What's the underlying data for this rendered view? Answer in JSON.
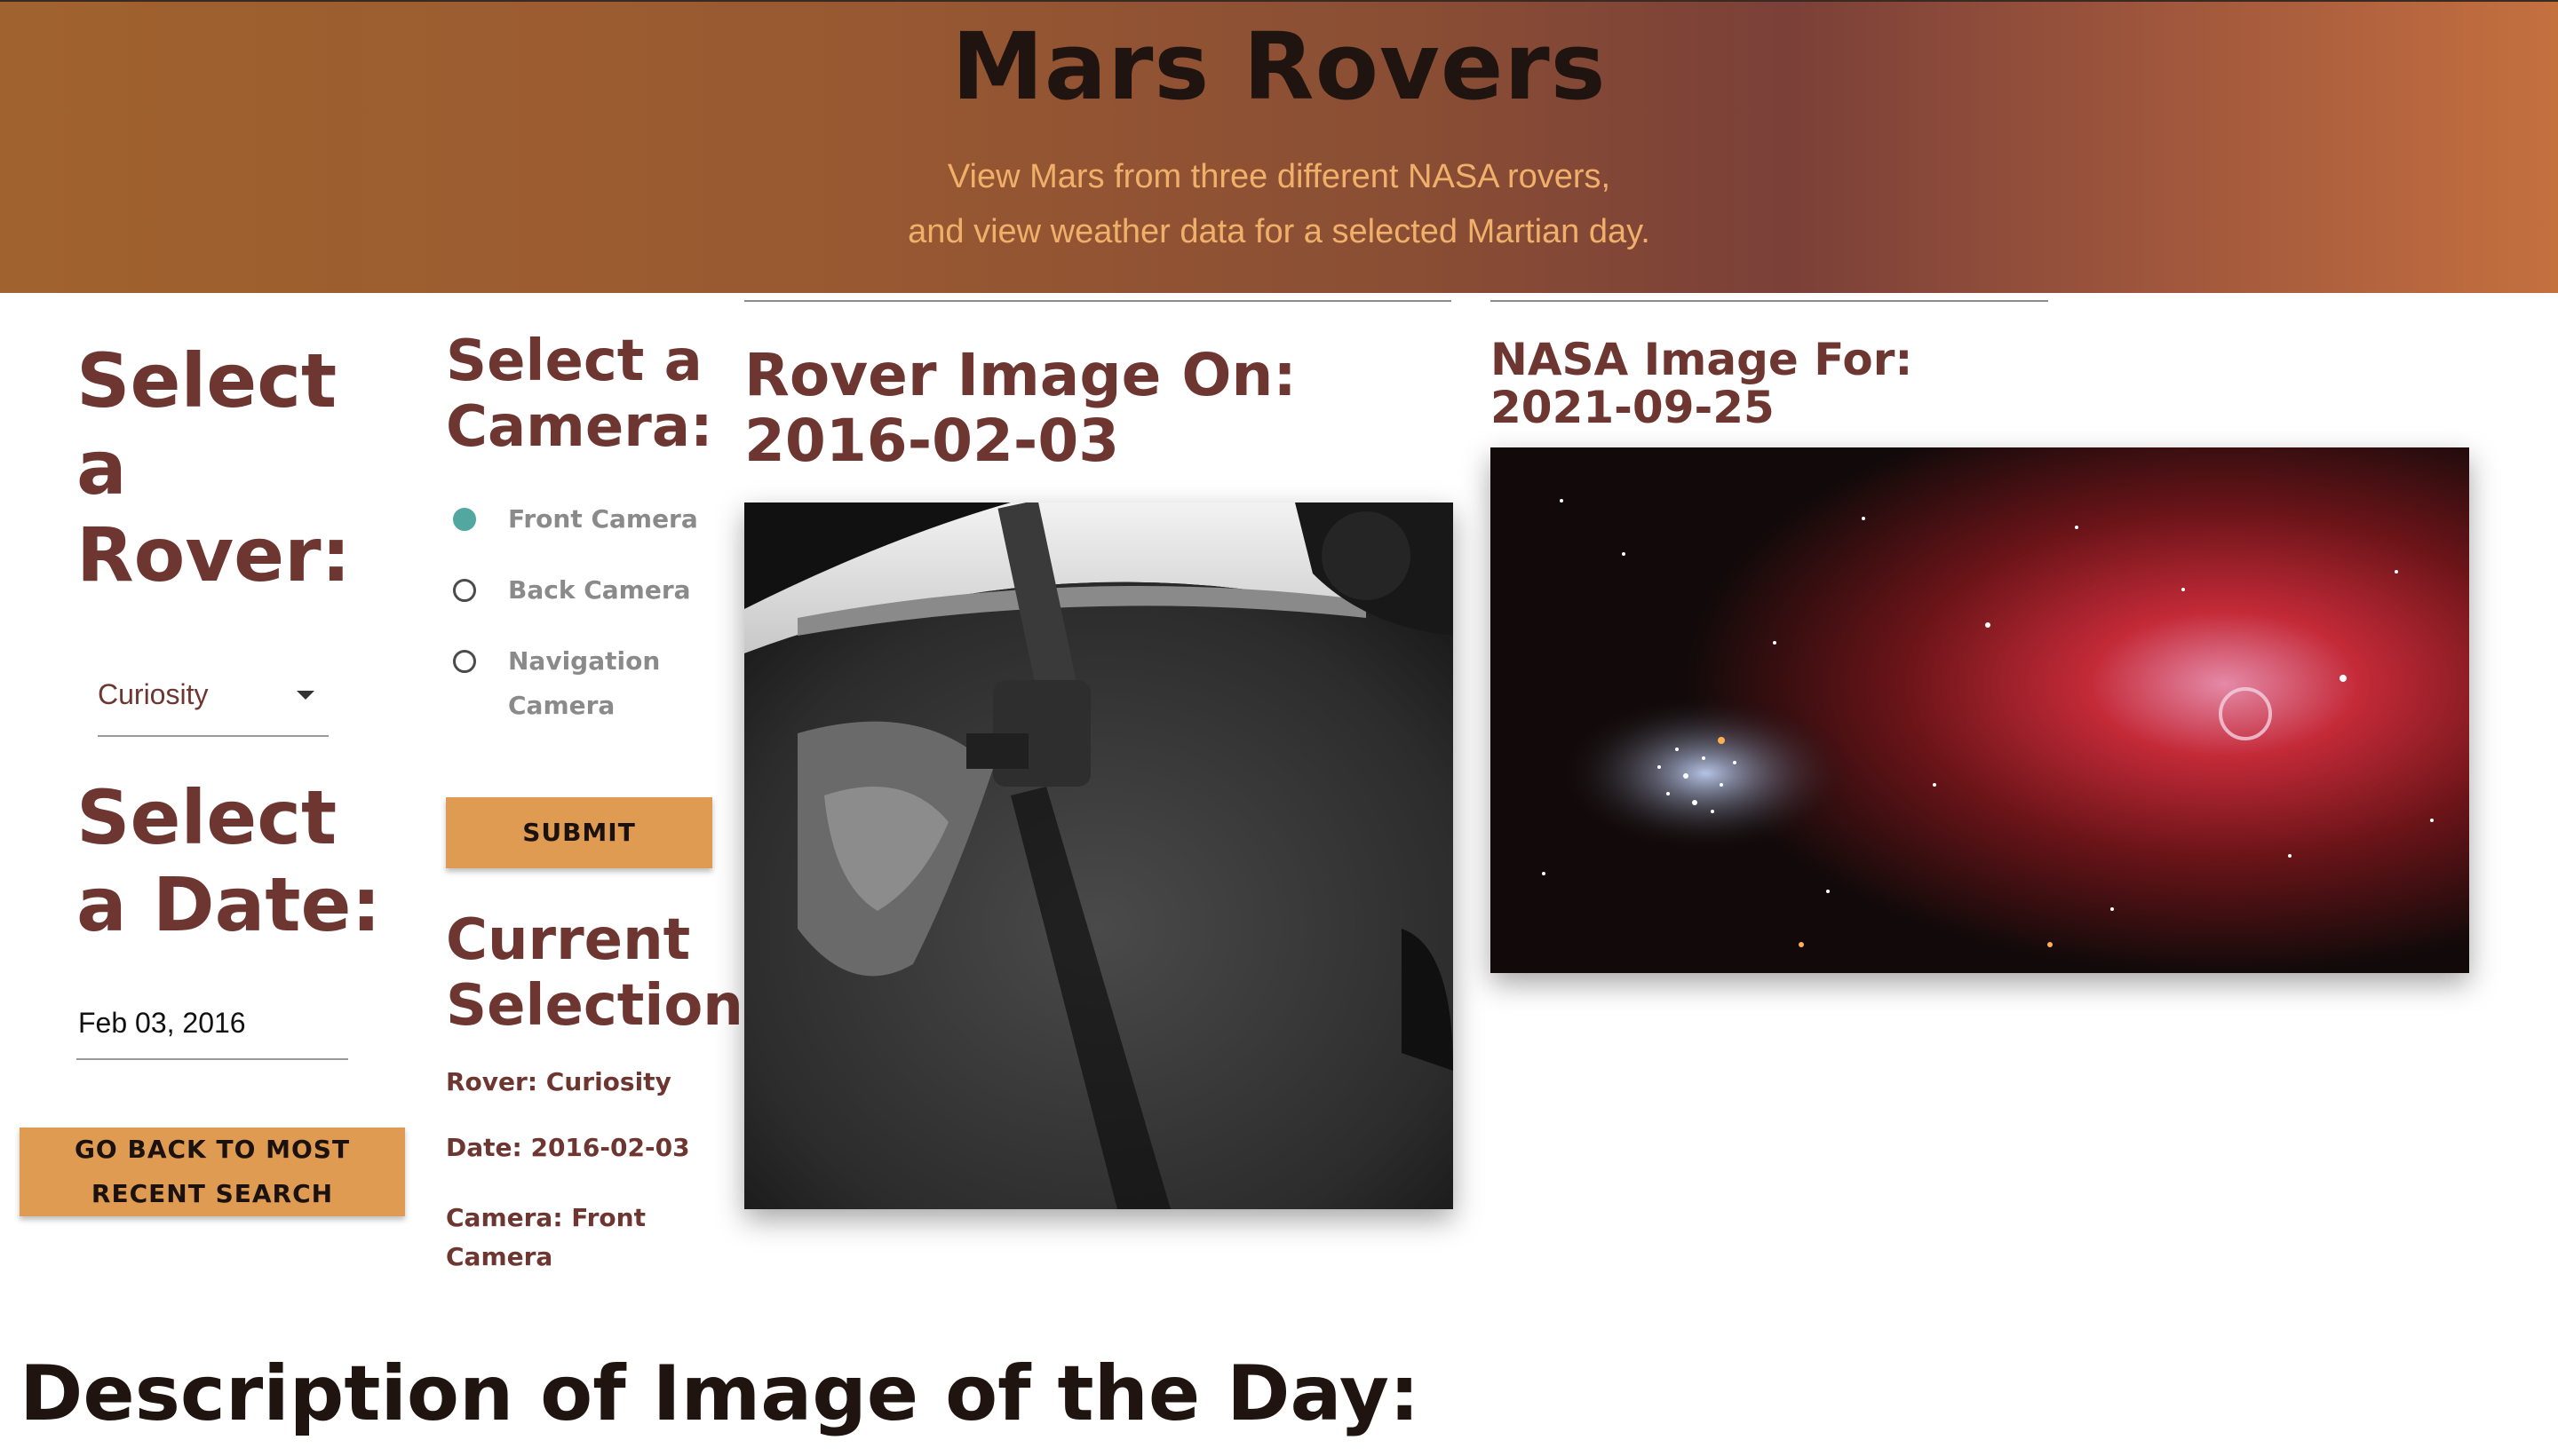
{
  "header": {
    "title": "Mars Rovers",
    "subtitle_line1": "View Mars from three different NASA rovers,",
    "subtitle_line2": "and view weather data for a selected Martian day."
  },
  "rover": {
    "heading": "Select a Rover:",
    "selected": "Curiosity"
  },
  "date": {
    "heading": "Select a Date:",
    "value": "Feb 03, 2016"
  },
  "back_button": "GO BACK TO MOST RECENT SEARCH",
  "camera": {
    "heading": "Select a Camera:",
    "options": [
      {
        "label": "Front Camera",
        "checked": true
      },
      {
        "label": "Back Camera",
        "checked": false
      },
      {
        "label": "Navigation Camera",
        "checked": false
      }
    ]
  },
  "submit_button": "SUBMIT",
  "current_selection": {
    "heading": "Current Selection:",
    "rover": "Rover: Curiosity",
    "date": "Date: 2016-02-03",
    "camera": "Camera: Front Camera"
  },
  "rover_image": {
    "title": "Rover Image On: 2016-02-03"
  },
  "nasa_image": {
    "title": "NASA Image For: 2021-09-25"
  },
  "description": {
    "heading": "Description of Image of the Day:"
  },
  "colors": {
    "heading_brown": "#6e3631",
    "button_orange": "#e09b52",
    "radio_teal": "#52a8a0",
    "subtitle_orange": "#f0b06a"
  }
}
